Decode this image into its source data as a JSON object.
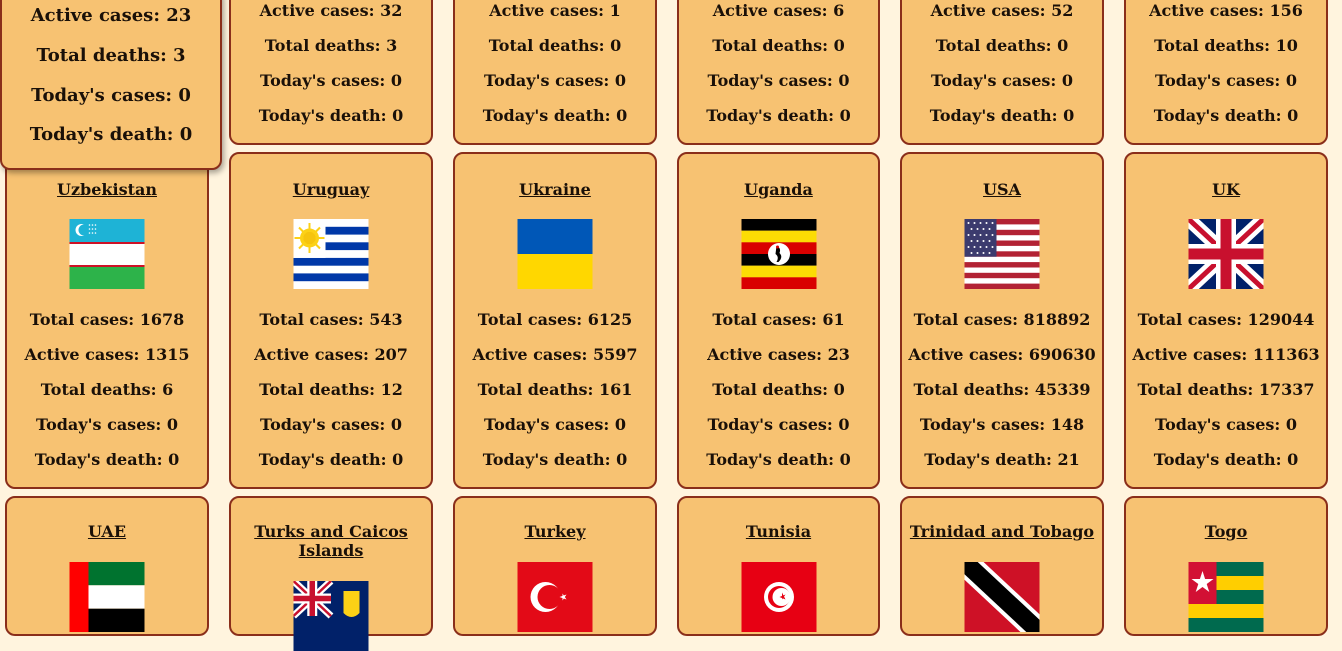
{
  "popup": {
    "active": "Active cases: 23",
    "deaths": "Total deaths: 3",
    "today_cases": "Today's cases: 0",
    "today_death": "Today's death: 0"
  },
  "top_row": [
    {
      "active": "Active cases: 32",
      "deaths": "Total deaths: 3",
      "today_cases": "Today's cases: 0",
      "today_death": "Today's death: 0"
    },
    {
      "active": "Active cases: 1",
      "deaths": "Total deaths: 0",
      "today_cases": "Today's cases: 0",
      "today_death": "Today's death: 0"
    },
    {
      "active": "Active cases: 6",
      "deaths": "Total deaths: 0",
      "today_cases": "Today's cases: 0",
      "today_death": "Today's death: 0"
    },
    {
      "active": "Active cases: 52",
      "deaths": "Total deaths: 0",
      "today_cases": "Today's cases: 0",
      "today_death": "Today's death: 0"
    },
    {
      "active": "Active cases: 156",
      "deaths": "Total deaths: 10",
      "today_cases": "Today's cases: 0",
      "today_death": "Today's death: 0"
    }
  ],
  "middle_row": [
    {
      "name": "Uzbekistan",
      "flag": "uzbekistan-flag-icon",
      "total": "Total cases: 1678",
      "active": "Active cases: 1315",
      "deaths": "Total deaths: 6",
      "today_cases": "Today's cases: 0",
      "today_death": "Today's death: 0"
    },
    {
      "name": "Uruguay",
      "flag": "uruguay-flag-icon",
      "total": "Total cases: 543",
      "active": "Active cases: 207",
      "deaths": "Total deaths: 12",
      "today_cases": "Today's cases: 0",
      "today_death": "Today's death: 0"
    },
    {
      "name": "Ukraine",
      "flag": "ukraine-flag-icon",
      "total": "Total cases: 6125",
      "active": "Active cases: 5597",
      "deaths": "Total deaths: 161",
      "today_cases": "Today's cases: 0",
      "today_death": "Today's death: 0"
    },
    {
      "name": "Uganda",
      "flag": "uganda-flag-icon",
      "total": "Total cases: 61",
      "active": "Active cases: 23",
      "deaths": "Total deaths: 0",
      "today_cases": "Today's cases: 0",
      "today_death": "Today's death: 0"
    },
    {
      "name": "USA",
      "flag": "usa-flag-icon",
      "total": "Total cases: 818892",
      "active": "Active cases: 690630",
      "deaths": "Total deaths: 45339",
      "today_cases": "Today's cases: 148",
      "today_death": "Today's death: 21"
    },
    {
      "name": "UK",
      "flag": "uk-flag-icon",
      "total": "Total cases: 129044",
      "active": "Active cases: 111363",
      "deaths": "Total deaths: 17337",
      "today_cases": "Today's cases: 0",
      "today_death": "Today's death: 0"
    }
  ],
  "bottom_row": [
    {
      "name": "UAE",
      "flag": "uae-flag-icon"
    },
    {
      "name": "Turks and Caicos Islands",
      "flag": "turks-and-caicos-flag-icon"
    },
    {
      "name": "Turkey",
      "flag": "turkey-flag-icon"
    },
    {
      "name": "Tunisia",
      "flag": "tunisia-flag-icon"
    },
    {
      "name": "Trinidad and Tobago",
      "flag": "trinidad-and-tobago-flag-icon"
    },
    {
      "name": "Togo",
      "flag": "togo-flag-icon"
    }
  ],
  "colors": {
    "card": "#f7c272",
    "border": "#8a2e1a",
    "background": "#fff4de"
  }
}
